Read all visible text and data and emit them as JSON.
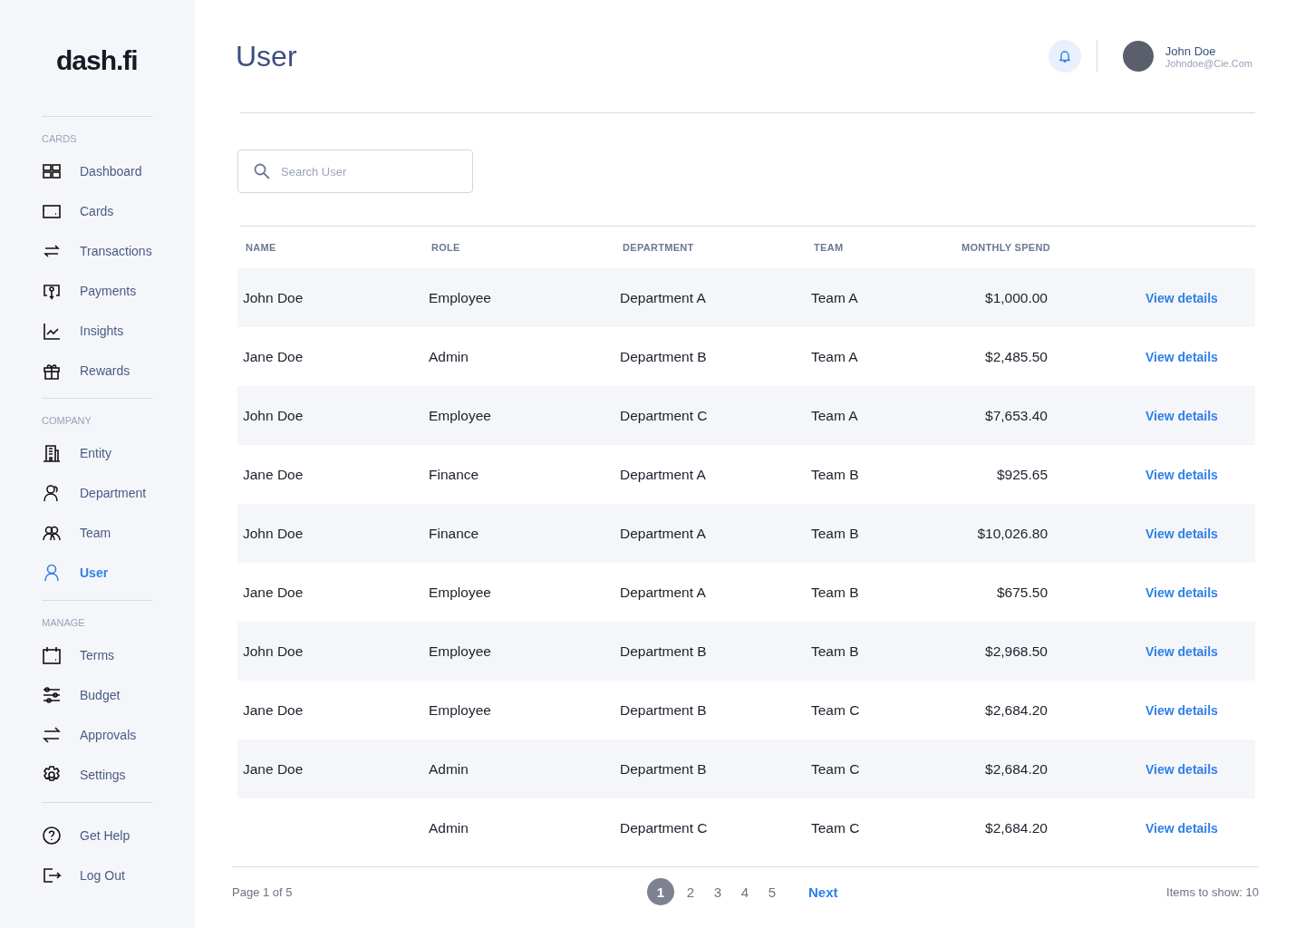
{
  "logo": "dash.fi",
  "sidebar": {
    "sections": [
      {
        "title": "CARDS",
        "items": [
          {
            "label": "Dashboard",
            "selected": false
          },
          {
            "label": "Cards",
            "selected": false
          },
          {
            "label": "Transactions",
            "selected": false
          },
          {
            "label": "Payments",
            "selected": false
          },
          {
            "label": "Insights",
            "selected": false
          },
          {
            "label": "Rewards",
            "selected": false
          }
        ]
      },
      {
        "title": "COMPANY",
        "items": [
          {
            "label": "Entity",
            "selected": false
          },
          {
            "label": "Department",
            "selected": false
          },
          {
            "label": "Team",
            "selected": false
          },
          {
            "label": "User",
            "selected": true
          }
        ]
      },
      {
        "title": "MANAGE",
        "items": [
          {
            "label": "Terms",
            "selected": false
          },
          {
            "label": "Budget",
            "selected": false
          },
          {
            "label": "Approvals",
            "selected": false
          },
          {
            "label": "Settings",
            "selected": false
          }
        ]
      },
      {
        "items": [
          {
            "label": "Get Help",
            "selected": false
          },
          {
            "label": "Log Out",
            "selected": false
          }
        ]
      }
    ]
  },
  "header": {
    "title": "User",
    "user": {
      "name": "John Doe",
      "email": "Johndoe@Cie.Com"
    }
  },
  "search": {
    "placeholder": "Search User"
  },
  "table": {
    "columns": [
      "NAME",
      "ROLE",
      "DEPARTMENT",
      "TEAM",
      "MONTHLY SPEND"
    ],
    "rows": [
      {
        "name": "John Doe",
        "role": "Employee",
        "department": "Department A",
        "team": "Team A",
        "spend": "$1,000.00",
        "action": "View details"
      },
      {
        "name": "Jane Doe",
        "role": "Admin",
        "department": "Department B",
        "team": "Team A",
        "spend": "$2,485.50",
        "action": "View details"
      },
      {
        "name": "John Doe",
        "role": "Employee",
        "department": "Department C",
        "team": "Team A",
        "spend": "$7,653.40",
        "action": "View details"
      },
      {
        "name": "Jane Doe",
        "role": "Finance",
        "department": "Department A",
        "team": "Team B",
        "spend": "$925.65",
        "action": "View details"
      },
      {
        "name": "John Doe",
        "role": "Finance",
        "department": "Department A",
        "team": "Team B",
        "spend": "$10,026.80",
        "action": "View details"
      },
      {
        "name": "Jane Doe",
        "role": "Employee",
        "department": "Department A",
        "team": "Team B",
        "spend": "$675.50",
        "action": "View details"
      },
      {
        "name": "John Doe",
        "role": "Employee",
        "department": "Department B",
        "team": "Team B",
        "spend": "$2,968.50",
        "action": "View details"
      },
      {
        "name": "Jane Doe",
        "role": "Employee",
        "department": "Department B",
        "team": "Team C",
        "spend": "$2,684.20",
        "action": "View details"
      },
      {
        "name": "Jane Doe",
        "role": "Admin",
        "department": "Department B",
        "team": "Team C",
        "spend": "$2,684.20",
        "action": "View details"
      },
      {
        "role": "Admin",
        "department": "Department C",
        "team": "Team C",
        "spend": "$2,684.20",
        "action": "View details"
      }
    ]
  },
  "pagination": {
    "summary": "Page 1 of 5",
    "pages": [
      {
        "label": "1",
        "selected": true
      },
      {
        "label": "2",
        "selected": false
      },
      {
        "label": "3",
        "selected": false
      },
      {
        "label": "4",
        "selected": false
      },
      {
        "label": "5",
        "selected": false
      }
    ],
    "next": "Next",
    "items_to_show": "Items to show: 10"
  }
}
